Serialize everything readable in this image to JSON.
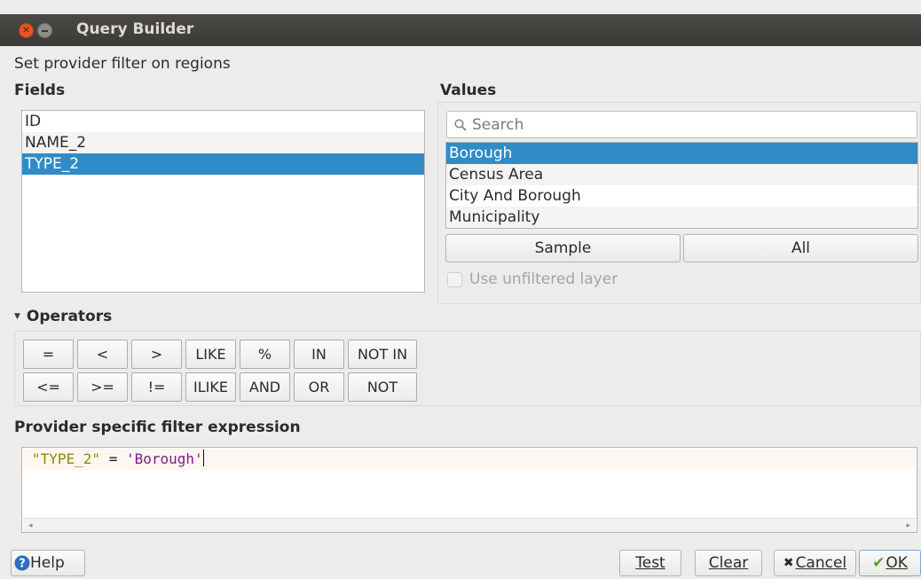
{
  "window": {
    "title": "Query Builder"
  },
  "dialog": {
    "description": "Set provider filter on regions"
  },
  "fields": {
    "heading": "Fields",
    "items": [
      "ID",
      "NAME_2",
      "TYPE_2"
    ],
    "selected": "TYPE_2"
  },
  "values": {
    "heading": "Values",
    "search_placeholder": "Search",
    "items": [
      "Borough",
      "Census Area",
      "City And Borough",
      "Municipality"
    ],
    "selected": "Borough",
    "sample_label": "Sample",
    "all_label": "All",
    "unfiltered_label": "Use unfiltered layer",
    "unfiltered_checked": false
  },
  "operators": {
    "heading": "Operators",
    "row1": [
      "=",
      "<",
      ">",
      "LIKE",
      "%",
      "IN",
      "NOT IN"
    ],
    "row2": [
      "<=",
      ">=",
      "!=",
      "ILIKE",
      "AND",
      "OR",
      "NOT"
    ]
  },
  "expression": {
    "heading": "Provider specific filter expression",
    "field_token": "\"TYPE_2\"",
    "operator_token": " = ",
    "value_token": "'Borough'"
  },
  "footer": {
    "help_label": "Help",
    "test_label": "Test",
    "clear_label": "Clear",
    "cancel_label": "Cancel",
    "ok_label": "OK"
  },
  "colors": {
    "selection": "#308cc6",
    "titlebar": "#3b3a37",
    "close_button": "#e95420"
  }
}
